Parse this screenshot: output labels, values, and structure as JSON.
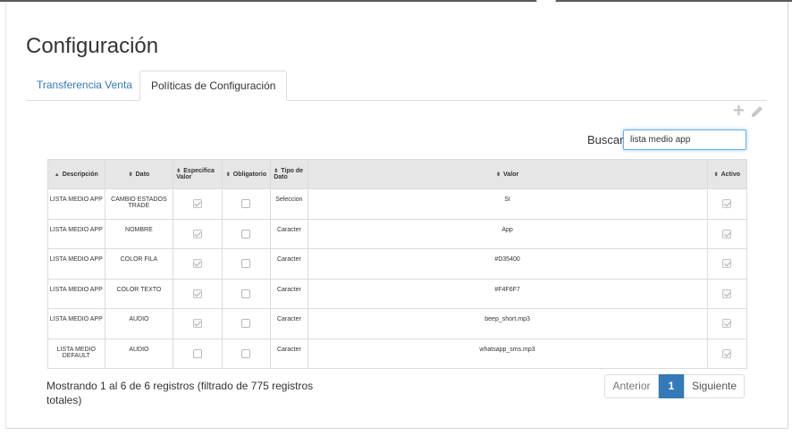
{
  "page": {
    "title": "Configuración"
  },
  "tabs": [
    {
      "label": "Transferencia Venta",
      "active": false
    },
    {
      "label": "Políticas de Configuración",
      "active": true
    }
  ],
  "toolbar": {
    "icons": [
      "plus-icon",
      "pencil-icon"
    ]
  },
  "search": {
    "label": "Buscar:",
    "value": "lista medio app"
  },
  "table": {
    "columns": [
      "Descripción",
      "Dato",
      "Especifica Valor",
      "Obligatorio",
      "Tipo de Dato",
      "Valor",
      "Activo"
    ],
    "rows": [
      {
        "descripcion": "LISTA MEDIO APP",
        "dato": "CAMBIO ESTADOS TRADE",
        "especifica_valor": true,
        "obligatorio": false,
        "tipo_dato": "Seleccion",
        "valor": "SI",
        "activo": true
      },
      {
        "descripcion": "LISTA MEDIO APP",
        "dato": "NOMBRE",
        "especifica_valor": true,
        "obligatorio": false,
        "tipo_dato": "Caracter",
        "valor": "App",
        "activo": true
      },
      {
        "descripcion": "LISTA MEDIO APP",
        "dato": "COLOR FILA",
        "especifica_valor": true,
        "obligatorio": false,
        "tipo_dato": "Caracter",
        "valor": "#D35400",
        "activo": true
      },
      {
        "descripcion": "LISTA MEDIO APP",
        "dato": "COLOR TEXTO",
        "especifica_valor": true,
        "obligatorio": false,
        "tipo_dato": "Caracter",
        "valor": "#F4F6F7",
        "activo": true
      },
      {
        "descripcion": "LISTA MEDIO APP",
        "dato": "AUDIO",
        "especifica_valor": true,
        "obligatorio": false,
        "tipo_dato": "Caracter",
        "valor": "beep_short.mp3",
        "activo": true
      },
      {
        "descripcion": "LISTA MEDIO DEFAULT",
        "dato": "AUDIO",
        "especifica_valor": false,
        "obligatorio": false,
        "tipo_dato": "Caracter",
        "valor": "whatsapp_sms.mp3",
        "activo": true
      }
    ]
  },
  "footer": {
    "info": "Mostrando 1 al 6 de 6 registros (filtrado de 775 registros totales)",
    "prev_label": "Anterior",
    "page": "1",
    "next_label": "Siguiente"
  },
  "colors": {
    "accent": "#337ab7",
    "header_bg": "#e6e6e6",
    "focus": "#66afe9"
  }
}
